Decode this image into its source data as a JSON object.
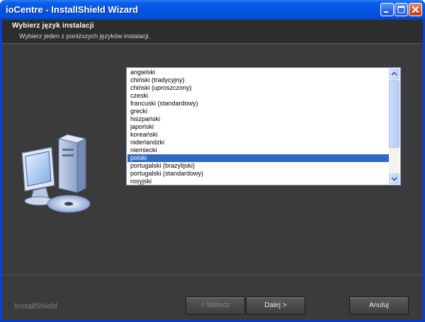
{
  "window": {
    "title": "ioCentre - InstallShield Wizard"
  },
  "header": {
    "title": "Wybierz język instalacji",
    "subtitle": "Wybierz jeden z poniższych języków instalacji."
  },
  "language_list": {
    "items": [
      "angielski",
      "chiński (tradycyjny)",
      "chiński (uproszczony)",
      "czeski",
      "francuski (standardowy)",
      "grecki",
      "hiszpański",
      "japoński",
      "koreański",
      "niderlandzki",
      "niemiecki",
      "polski",
      "portugalski (brazylijski)",
      "portugalski (standardowy)",
      "rosyjski"
    ],
    "selected_index": 11
  },
  "footer": {
    "brand": "InstallShield",
    "back_label": "< Wstecz",
    "next_label": "Dalej >",
    "cancel_label": "Anuluj"
  },
  "colors": {
    "selection": "#316ac5",
    "client_bg": "#3b3b3b",
    "titlebar": "#0554e4"
  }
}
